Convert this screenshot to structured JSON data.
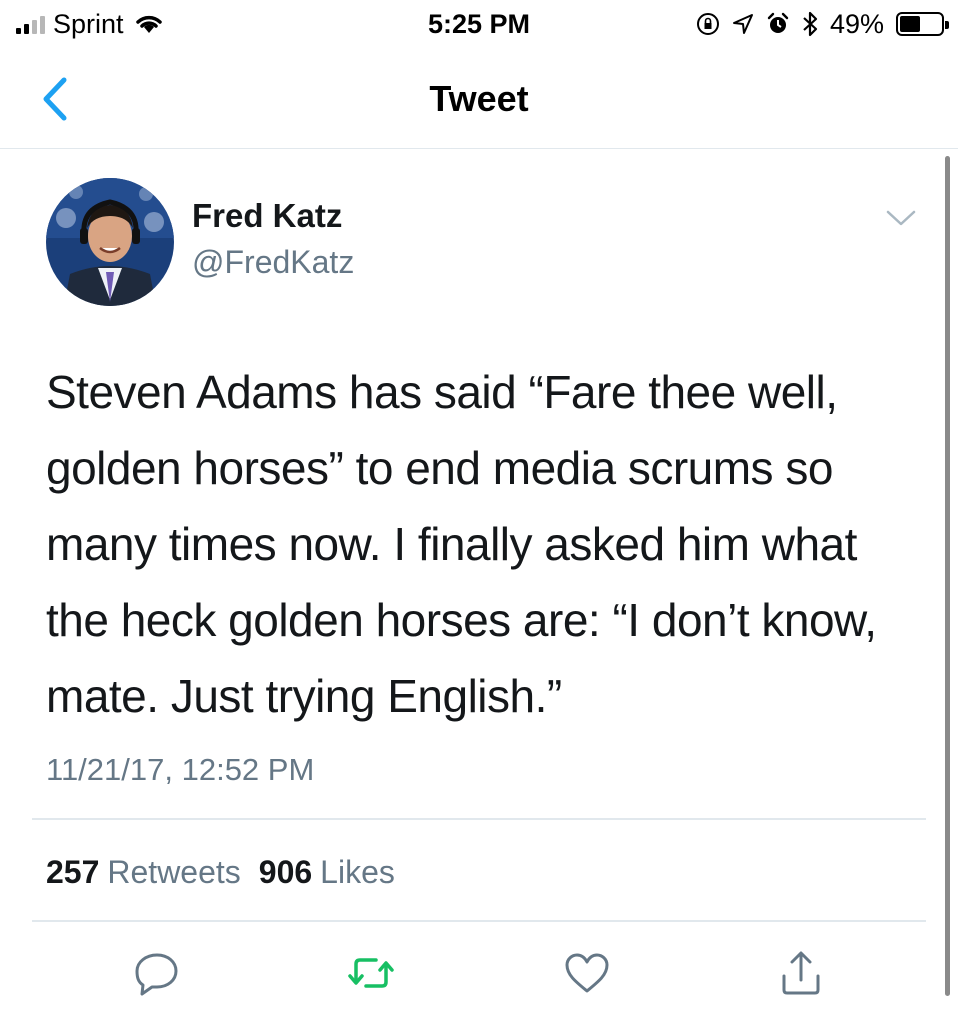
{
  "status_bar": {
    "carrier": "Sprint",
    "time": "5:25 PM",
    "battery_percent": "49%",
    "battery_level": 0.49,
    "signal_bars": 2,
    "icons": [
      "signal-icon",
      "wifi-icon",
      "rotation-lock-icon",
      "location-icon",
      "alarm-icon",
      "bluetooth-icon",
      "battery-icon"
    ]
  },
  "nav": {
    "title": "Tweet",
    "back_icon": "chevron-left-icon",
    "accent_color": "#1da1f2"
  },
  "tweet": {
    "author_name": "Fred Katz",
    "author_handle": "@FredKatz",
    "text": "Steven Adams has said “Fare thee well, golden horses” to end media scrums so many times now. I finally asked him what the heck golden horses are: “I don’t know, mate. Just trying English.”",
    "timestamp": "11/21/17, 12:52 PM",
    "retweets_count": "257",
    "retweets_label": "Retweets",
    "likes_count": "906",
    "likes_label": "Likes"
  },
  "actions": {
    "reply_icon": "reply-icon",
    "retweet_icon": "retweet-icon",
    "like_icon": "heart-icon",
    "share_icon": "share-icon",
    "retweet_color": "#17bf63",
    "icon_color": "#657786"
  }
}
